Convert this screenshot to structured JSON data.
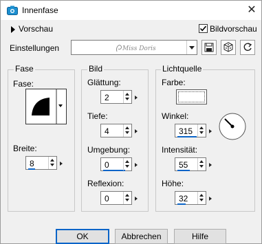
{
  "window": {
    "title": "Innenfase",
    "close_symbol": "✕"
  },
  "preview": {
    "toggle_label": "Vorschau",
    "live_preview_label": "Bildvorschau",
    "live_preview_checked": true
  },
  "settings": {
    "label": "Einstellungen",
    "preset_value": ""
  },
  "groups": {
    "fase": {
      "title": "Fase",
      "bevel_label": "Fase:",
      "width_label": "Breite:",
      "width_value": "8"
    },
    "bild": {
      "title": "Bild",
      "smoothness_label": "Glättung:",
      "smoothness_value": "2",
      "depth_label": "Tiefe:",
      "depth_value": "4",
      "ambience_label": "Umgebung:",
      "ambience_value": "0",
      "reflection_label": "Reflexion:",
      "reflection_value": "0"
    },
    "licht": {
      "title": "Lichtquelle",
      "color_label": "Farbe:",
      "color": "#ffffff",
      "angle_label": "Winkel:",
      "angle_value": "315",
      "intensity_label": "Intensität:",
      "intensity_value": "55",
      "elevation_label": "Höhe:",
      "elevation_value": "32"
    }
  },
  "buttons": {
    "ok": "OK",
    "cancel": "Abbrechen",
    "help": "Hilfe"
  },
  "colors": {
    "accent": "#0a64c8",
    "title_icon": "#1c8fd0"
  }
}
